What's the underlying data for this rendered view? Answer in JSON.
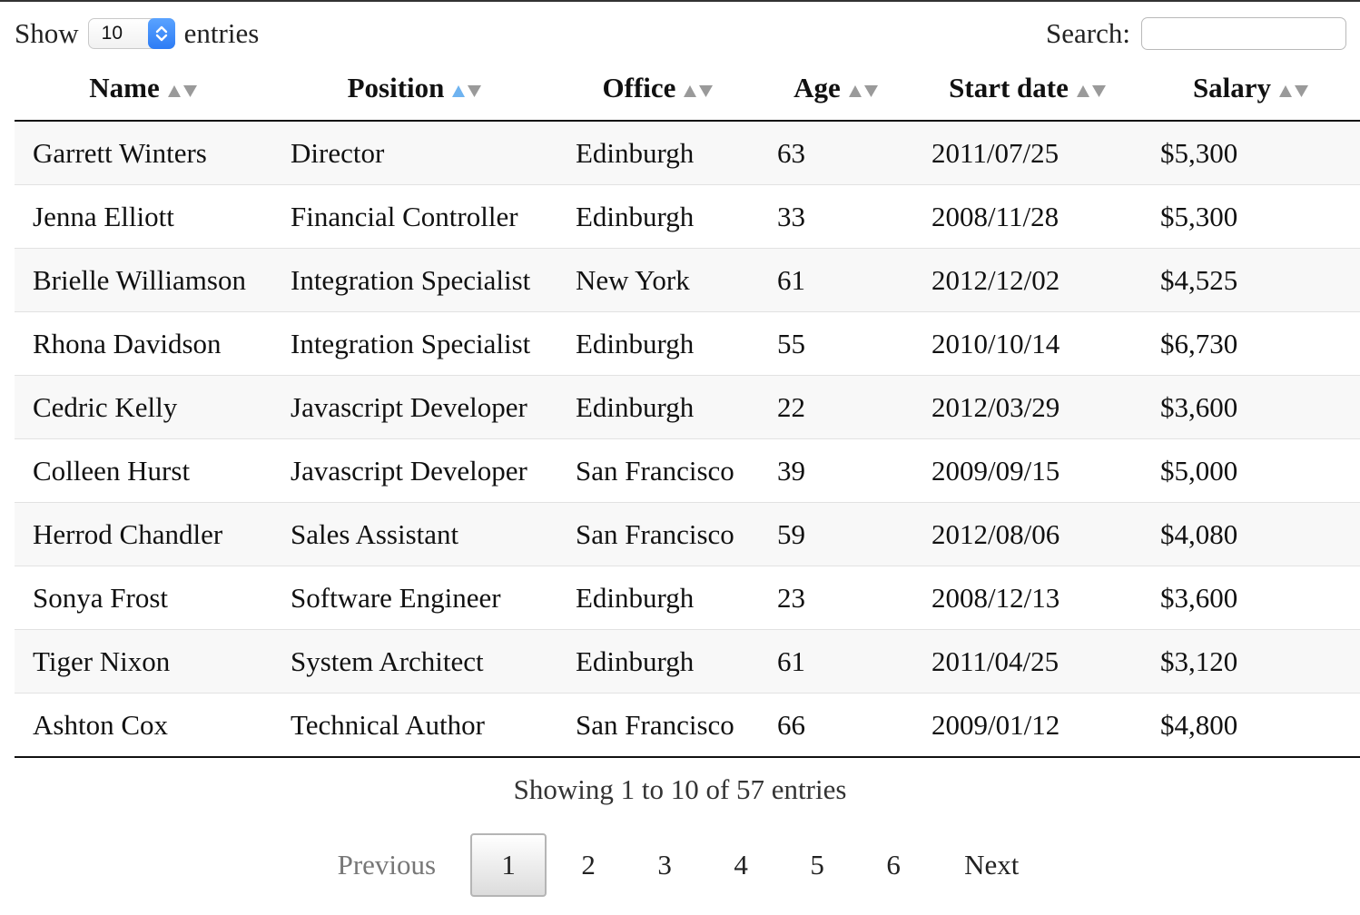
{
  "length_menu": {
    "prefix": "Show",
    "value": "10",
    "suffix": "entries"
  },
  "search": {
    "label": "Search:",
    "value": ""
  },
  "table": {
    "columns": [
      {
        "label": "Name",
        "sort": "none"
      },
      {
        "label": "Position",
        "sort": "ascending"
      },
      {
        "label": "Office",
        "sort": "none"
      },
      {
        "label": "Age",
        "sort": "none"
      },
      {
        "label": "Start date",
        "sort": "none"
      },
      {
        "label": "Salary",
        "sort": "none"
      }
    ],
    "rows": [
      [
        "Garrett Winters",
        "Director",
        "Edinburgh",
        "63",
        "2011/07/25",
        "$5,300"
      ],
      [
        "Jenna Elliott",
        "Financial Controller",
        "Edinburgh",
        "33",
        "2008/11/28",
        "$5,300"
      ],
      [
        "Brielle Williamson",
        "Integration Specialist",
        "New York",
        "61",
        "2012/12/02",
        "$4,525"
      ],
      [
        "Rhona Davidson",
        "Integration Specialist",
        "Edinburgh",
        "55",
        "2010/10/14",
        "$6,730"
      ],
      [
        "Cedric Kelly",
        "Javascript Developer",
        "Edinburgh",
        "22",
        "2012/03/29",
        "$3,600"
      ],
      [
        "Colleen Hurst",
        "Javascript Developer",
        "San Francisco",
        "39",
        "2009/09/15",
        "$5,000"
      ],
      [
        "Herrod Chandler",
        "Sales Assistant",
        "San Francisco",
        "59",
        "2012/08/06",
        "$4,080"
      ],
      [
        "Sonya Frost",
        "Software Engineer",
        "Edinburgh",
        "23",
        "2008/12/13",
        "$3,600"
      ],
      [
        "Tiger Nixon",
        "System Architect",
        "Edinburgh",
        "61",
        "2011/04/25",
        "$3,120"
      ],
      [
        "Ashton Cox",
        "Technical Author",
        "San Francisco",
        "66",
        "2009/01/12",
        "$4,800"
      ]
    ]
  },
  "info": "Showing 1 to 10 of 57 entries",
  "pagination": {
    "previous": "Previous",
    "pages": [
      "1",
      "2",
      "3",
      "4",
      "5",
      "6"
    ],
    "current": "1",
    "next": "Next"
  },
  "colors": {
    "sort_active": "#6fb3f0",
    "sort_inactive": "#9a9a9a",
    "stripe": "#f8f8f8",
    "select_accent": "#2d7cf5"
  }
}
